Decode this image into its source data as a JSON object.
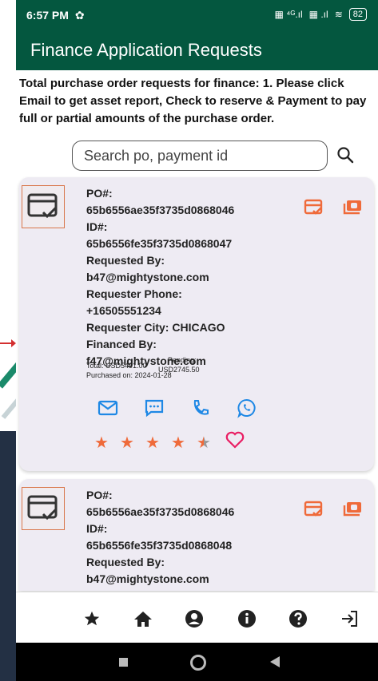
{
  "status": {
    "time": "6:57 PM",
    "battery": "82"
  },
  "appbar": {
    "title": "Finance Application Requests"
  },
  "intro": {
    "text": "Total purchase order requests for finance: 1. Please click Email to get asset report, Check to reserve & Payment to pay full or partial amounts of the purchase order."
  },
  "search": {
    "placeholder": "Search po, payment id"
  },
  "cards": [
    {
      "po_label": "PO#:",
      "po": "65b6556ae35f3735d0868046",
      "id_label": "ID#:",
      "id": "65b6556fe35f3735d0868047",
      "requested_by_label": "Requested By:",
      "requested_by": "b47@mightystone.com",
      "phone_label": "Requester Phone:",
      "phone": "+16505551234",
      "city": "Requester City: CHICAGO",
      "financed_by_label": "Financed By:",
      "financed_by": "f47@mightystone.com",
      "total": "Total: USD5491.00",
      "purchased_on": "Purchased on: 2024-01-28",
      "pending_label": "Pending:",
      "pending": "USD2745.50",
      "rating": 4.5
    },
    {
      "po_label": "PO#:",
      "po": "65b6556ae35f3735d0868046",
      "id_label": "ID#:",
      "id": "65b6556fe35f3735d0868048",
      "requested_by_label": "Requested By:",
      "requested_by": "b47@mightystone.com"
    }
  ],
  "icons": {
    "accent": "#ef6a3a",
    "primary_green": "#04573f",
    "contact_blue": "#1e88e5"
  },
  "bottom_nav": [
    "star-icon",
    "home-icon",
    "account-icon",
    "info-icon",
    "help-icon",
    "logout-icon"
  ]
}
